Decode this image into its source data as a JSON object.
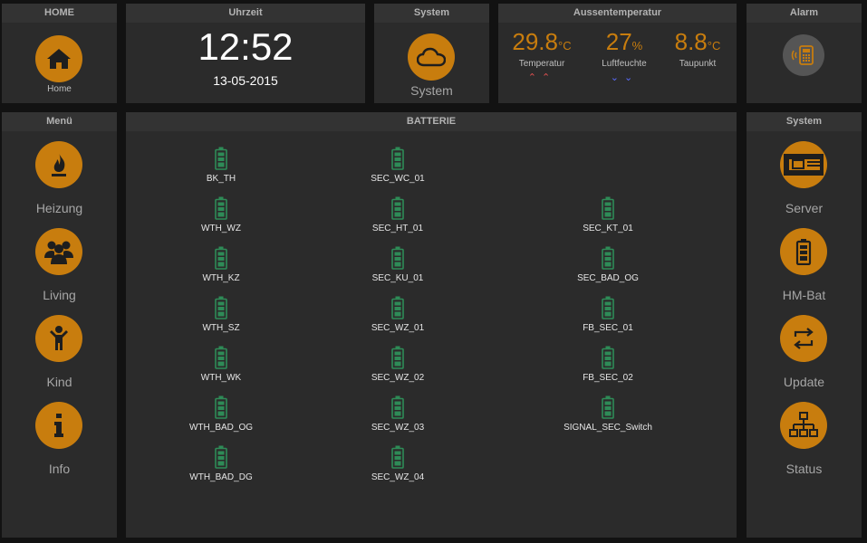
{
  "home": {
    "title": "HOME",
    "label": "Home"
  },
  "clock": {
    "title": "Uhrzeit",
    "time": "12:52",
    "date": "13-05-2015"
  },
  "system_top": {
    "title": "System",
    "label": "System"
  },
  "weather": {
    "title": "Aussentemperatur",
    "items": [
      {
        "value": "29.8",
        "unit": "°C",
        "name": "Temperatur",
        "trend": "⌃⌃",
        "trend_color": "#e05050"
      },
      {
        "value": "27",
        "unit": "%",
        "name": "Luftfeuchte",
        "trend": "⌄⌄",
        "trend_color": "#5a6cff"
      },
      {
        "value": "8.8",
        "unit": "°C",
        "name": "Taupunkt",
        "trend": "",
        "trend_color": "#bfbfbf"
      }
    ]
  },
  "alarm": {
    "title": "Alarm"
  },
  "menu": {
    "title": "Menü",
    "items": [
      {
        "label": "Heizung",
        "icon": "flame-icon"
      },
      {
        "label": "Living",
        "icon": "people-icon"
      },
      {
        "label": "Kind",
        "icon": "child-icon"
      },
      {
        "label": "Info",
        "icon": "info-icon"
      }
    ]
  },
  "batterie": {
    "title": "BATTERIE",
    "col1": [
      "BK_TH",
      "WTH_WZ",
      "WTH_KZ",
      "WTH_SZ",
      "WTH_WK",
      "WTH_BAD_OG",
      "WTH_BAD_DG"
    ],
    "col2": [
      "SEC_WC_01",
      "SEC_HT_01",
      "SEC_KU_01",
      "SEC_WZ_01",
      "SEC_WZ_02",
      "SEC_WZ_03",
      "SEC_WZ_04"
    ],
    "col3": [
      "SEC_KT_01",
      "SEC_BAD_OG",
      "FB_SEC_01",
      "FB_SEC_02",
      "SIGNAL_SEC_Switch"
    ]
  },
  "system_right": {
    "title": "System",
    "items": [
      {
        "label": "Server",
        "icon": "server-icon"
      },
      {
        "label": "HM-Bat",
        "icon": "battery-icon"
      },
      {
        "label": "Update",
        "icon": "update-icon"
      },
      {
        "label": "Status",
        "icon": "network-icon"
      }
    ]
  },
  "colors": {
    "accent": "#c87d0e",
    "battery_ok": "#2e8b57",
    "panel": "#2b2b2b",
    "background": "#121212"
  }
}
